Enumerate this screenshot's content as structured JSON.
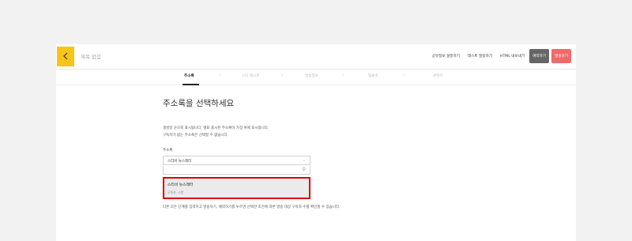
{
  "header": {
    "title": "제목 없음",
    "links": [
      "공유정보 설정하기",
      "테스트 발송하기",
      "HTML 내보내기"
    ],
    "schedule_label": "예약하기",
    "send_label": "발송하기"
  },
  "steps": [
    {
      "label": "주소록"
    },
    {
      "label": "스타 테스트"
    },
    {
      "label": "발송정보"
    },
    {
      "label": "템플릿"
    },
    {
      "label": "콘텐츠"
    }
  ],
  "main": {
    "heading": "주소록을 선택하세요",
    "desc_line1": "생성일 순으로 표시됩니다. 별표 표시된 주소록이 가장 위에 표시됩니다.",
    "desc_line2": "구독자가 없는 주소록은 선택할 수 없습니다.",
    "field_label": "주소록",
    "selected_value": "스티비 뉴스레터",
    "option_title": "스티비 뉴스레터",
    "option_sub": "구독자 : 0명",
    "note": "다른 모든 단계를 입력하고 발송하기, 예약하기를 누르면 선택한 조건에 따른 발송 대상 구독자 수를 확인할 수 있습니다."
  }
}
